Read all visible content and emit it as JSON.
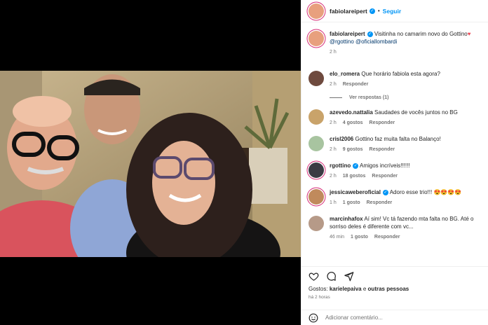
{
  "header": {
    "username": "fabiolareipert",
    "separator": "•",
    "follow_label": "Seguir"
  },
  "caption": {
    "username": "fabiolareipert",
    "text": "Visitinha no camarim novo do Gottino",
    "heart": "♥",
    "mentions": "@rgottino @oficiallombardi",
    "time": "2 h"
  },
  "comments": [
    {
      "user": "elo_romera",
      "verified": false,
      "text": "Que horário fabiola esta agora?",
      "time": "2 h",
      "likes": "",
      "reply": "Responder",
      "view_replies": "Ver respostas (1)"
    },
    {
      "user": "azevedo.nattalia",
      "verified": false,
      "text": "Saudades de vocês juntos no BG",
      "time": "2 h",
      "likes": "4 gostos",
      "reply": "Responder"
    },
    {
      "user": "crisl2006",
      "verified": false,
      "text": "Gottino faz muita falta no Balanço!",
      "time": "2 h",
      "likes": "9 gostos",
      "reply": "Responder"
    },
    {
      "user": "rgottino",
      "verified": true,
      "text": "Amigos incríveis!!!!!!",
      "time": "2 h",
      "likes": "18 gostos",
      "reply": "Responder"
    },
    {
      "user": "jessicaweberoficial",
      "verified": true,
      "text": "Adoro esse trio!!!",
      "emoji": "😍😍😍😍",
      "time": "1 h",
      "likes": "1 gosto",
      "reply": "Responder"
    },
    {
      "user": "marcinhafox",
      "verified": false,
      "text": "Aí sim! Vc tá fazendo mta falta no BG. Até o sorriso deles é diferente com vc...",
      "time": "46 min",
      "likes": "1 gosto",
      "reply": "Responder"
    }
  ],
  "likes": {
    "prefix": "Gostos:",
    "user": "karielepaiva",
    "conj": "e",
    "others": "outras pessoas"
  },
  "posted_time": "há 2 horas",
  "add_comment": {
    "placeholder": "Adicionar comentário..."
  },
  "icons": [
    "heart-icon",
    "comment-icon",
    "share-icon",
    "emoji-icon",
    "verified-icon"
  ],
  "colors": {
    "accent": "#0095f6",
    "heart": "#ed4956",
    "text": "#262626",
    "muted": "#737373"
  }
}
